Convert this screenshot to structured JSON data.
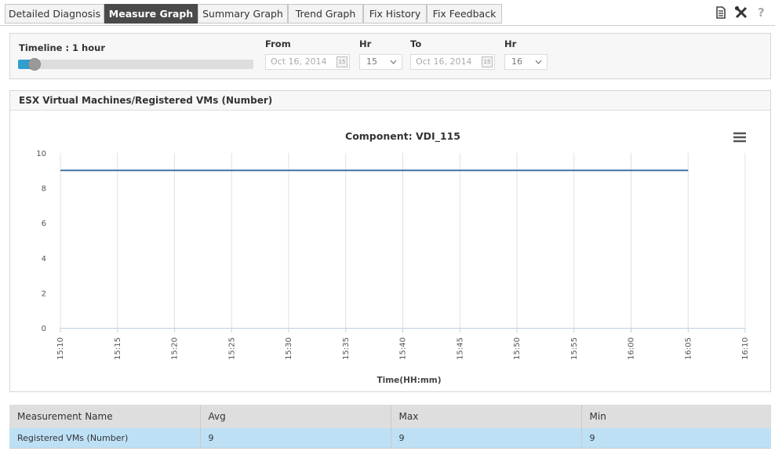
{
  "tabs": [
    {
      "label": "Detailed Diagnosis",
      "active": false
    },
    {
      "label": "Measure Graph",
      "active": true
    },
    {
      "label": "Summary Graph",
      "active": false
    },
    {
      "label": "Trend Graph",
      "active": false
    },
    {
      "label": "Fix History",
      "active": false
    },
    {
      "label": "Fix Feedback",
      "active": false
    }
  ],
  "toolbar": {
    "icons": [
      "document-icon",
      "tools-icon",
      "help-icon"
    ],
    "help_label": "?"
  },
  "timeline": {
    "label": "Timeline : 1 hour",
    "slider_fraction": 0.05,
    "from_label": "From",
    "from_date": "Oct 16, 2014",
    "from_hr_label": "Hr",
    "from_hr": "15",
    "to_label": "To",
    "to_date": "Oct 16, 2014",
    "to_hr_label": "Hr",
    "to_hr": "16",
    "calendar_day": "15"
  },
  "chart_panel": {
    "title": "ESX Virtual Machines/Registered VMs (Number)"
  },
  "chart_data": {
    "type": "line",
    "title": "Component: VDI_115",
    "xlabel": "Time(HH:mm)",
    "ylabel": "",
    "x": [
      "15:10",
      "15:15",
      "15:20",
      "15:25",
      "15:30",
      "15:35",
      "15:40",
      "15:45",
      "15:50",
      "15:55",
      "16:00",
      "16:05",
      "16:10"
    ],
    "y_ticks": [
      0,
      2,
      4,
      6,
      8,
      10
    ],
    "ylim": [
      0,
      10
    ],
    "series": [
      {
        "values": [
          {
            "x": "15:10",
            "y": 9
          },
          {
            "x": "16:05",
            "y": 9
          }
        ],
        "color": "#4572a7"
      }
    ],
    "grid": "vertical",
    "legend": "none"
  },
  "table": {
    "headers": [
      "Measurement Name",
      "Avg",
      "Max",
      "Min"
    ],
    "rows": [
      [
        "Registered VMs (Number)",
        "9",
        "9",
        "9"
      ]
    ]
  },
  "colors": {
    "accent": "#2f9fd0",
    "active_tab": "#4a4a4a",
    "row_highlight": "#bde0f5",
    "series": "#4572a7"
  }
}
